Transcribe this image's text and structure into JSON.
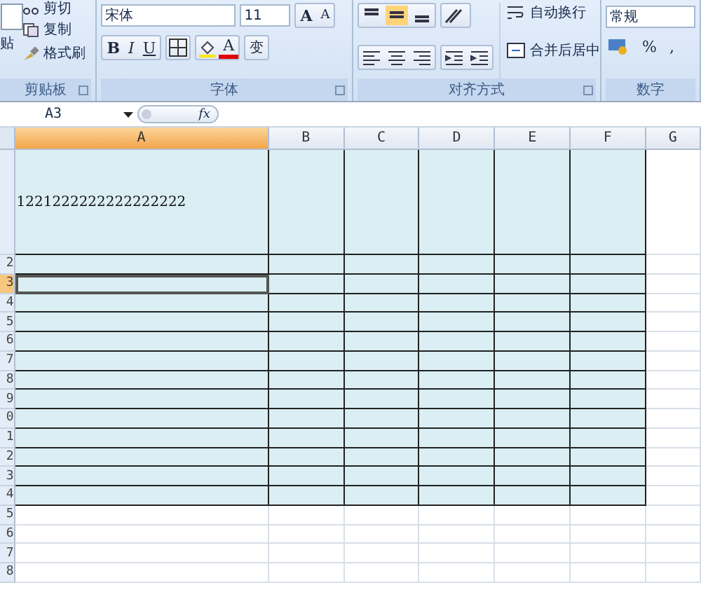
{
  "ribbon": {
    "clipboard": {
      "paste": "贴",
      "cut": "剪切",
      "copy": "复制",
      "format_painter": "格式刷",
      "label": "剪贴板"
    },
    "font": {
      "font_name": "宋体",
      "font_size": "11",
      "bold": "B",
      "italic": "I",
      "underline": "U",
      "grow": "A",
      "shrink": "A",
      "font_color": "A",
      "phonetic": "变",
      "label": "字体"
    },
    "alignment": {
      "wrap_text": "自动换行",
      "merge_center": "合并后居中",
      "label": "对齐方式"
    },
    "number": {
      "format": "常规",
      "percent": "%",
      "comma": ",",
      "label": "数字"
    }
  },
  "name_box": "A3",
  "formula_label": "fx",
  "sheet": {
    "columns": [
      {
        "label": "A",
        "selected": true
      },
      {
        "label": "B",
        "selected": false
      },
      {
        "label": "C",
        "selected": false
      },
      {
        "label": "D",
        "selected": false
      },
      {
        "label": "E",
        "selected": false
      },
      {
        "label": "F",
        "selected": false
      },
      {
        "label": "G",
        "selected": false
      }
    ],
    "rows": [
      {
        "label": "",
        "selected": false,
        "cell_a": "1221222222222222222"
      },
      {
        "label": "2",
        "selected": false
      },
      {
        "label": "3",
        "selected": true
      },
      {
        "label": "4",
        "selected": false
      },
      {
        "label": "5",
        "selected": false
      },
      {
        "label": "6",
        "selected": false
      },
      {
        "label": "7",
        "selected": false
      },
      {
        "label": "8",
        "selected": false
      },
      {
        "label": "9",
        "selected": false
      },
      {
        "label": "0",
        "selected": false
      },
      {
        "label": "1",
        "selected": false
      },
      {
        "label": "2",
        "selected": false
      },
      {
        "label": "3",
        "selected": false
      },
      {
        "label": "4",
        "selected": false
      },
      {
        "label": "5",
        "selected": false
      },
      {
        "label": "6",
        "selected": false
      },
      {
        "label": "7",
        "selected": false
      },
      {
        "label": "8",
        "selected": false
      }
    ]
  }
}
